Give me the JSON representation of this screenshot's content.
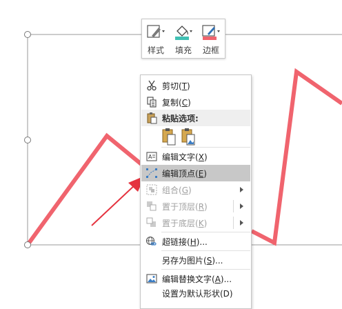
{
  "mini_toolbar": {
    "buttons": [
      {
        "label": "样式",
        "icon": "shape-style-icon"
      },
      {
        "label": "填充",
        "icon": "fill-bucket-icon"
      },
      {
        "label": "边框",
        "icon": "outline-pen-icon"
      }
    ]
  },
  "context_menu": {
    "cut": {
      "label": "剪切",
      "key": "T"
    },
    "copy": {
      "label": "复制",
      "key": "C"
    },
    "paste_options": {
      "label": "粘贴选项:"
    },
    "edit_text": {
      "label": "编辑文字",
      "key": "X"
    },
    "edit_points": {
      "label": "编辑顶点",
      "key": "E"
    },
    "group": {
      "label": "组合",
      "key": "G"
    },
    "bring_to_front": {
      "label": "置于顶层",
      "key": "R"
    },
    "send_to_back": {
      "label": "置于底层",
      "key": "K"
    },
    "hyperlink": {
      "label": "超链接",
      "key": "H",
      "suffix": "..."
    },
    "save_as_picture": {
      "label": "另存为图片",
      "key": "S",
      "suffix": "..."
    },
    "edit_alt_text": {
      "label": "编辑替换文字",
      "key": "A",
      "suffix": "..."
    },
    "set_default": {
      "label": "设置为默认形状(D)"
    }
  },
  "colors": {
    "accent_red": "#f0646e",
    "arrow_red": "#e5333f",
    "fill_teal": "#41c0b4",
    "hover_gray": "#c8c8c8"
  }
}
